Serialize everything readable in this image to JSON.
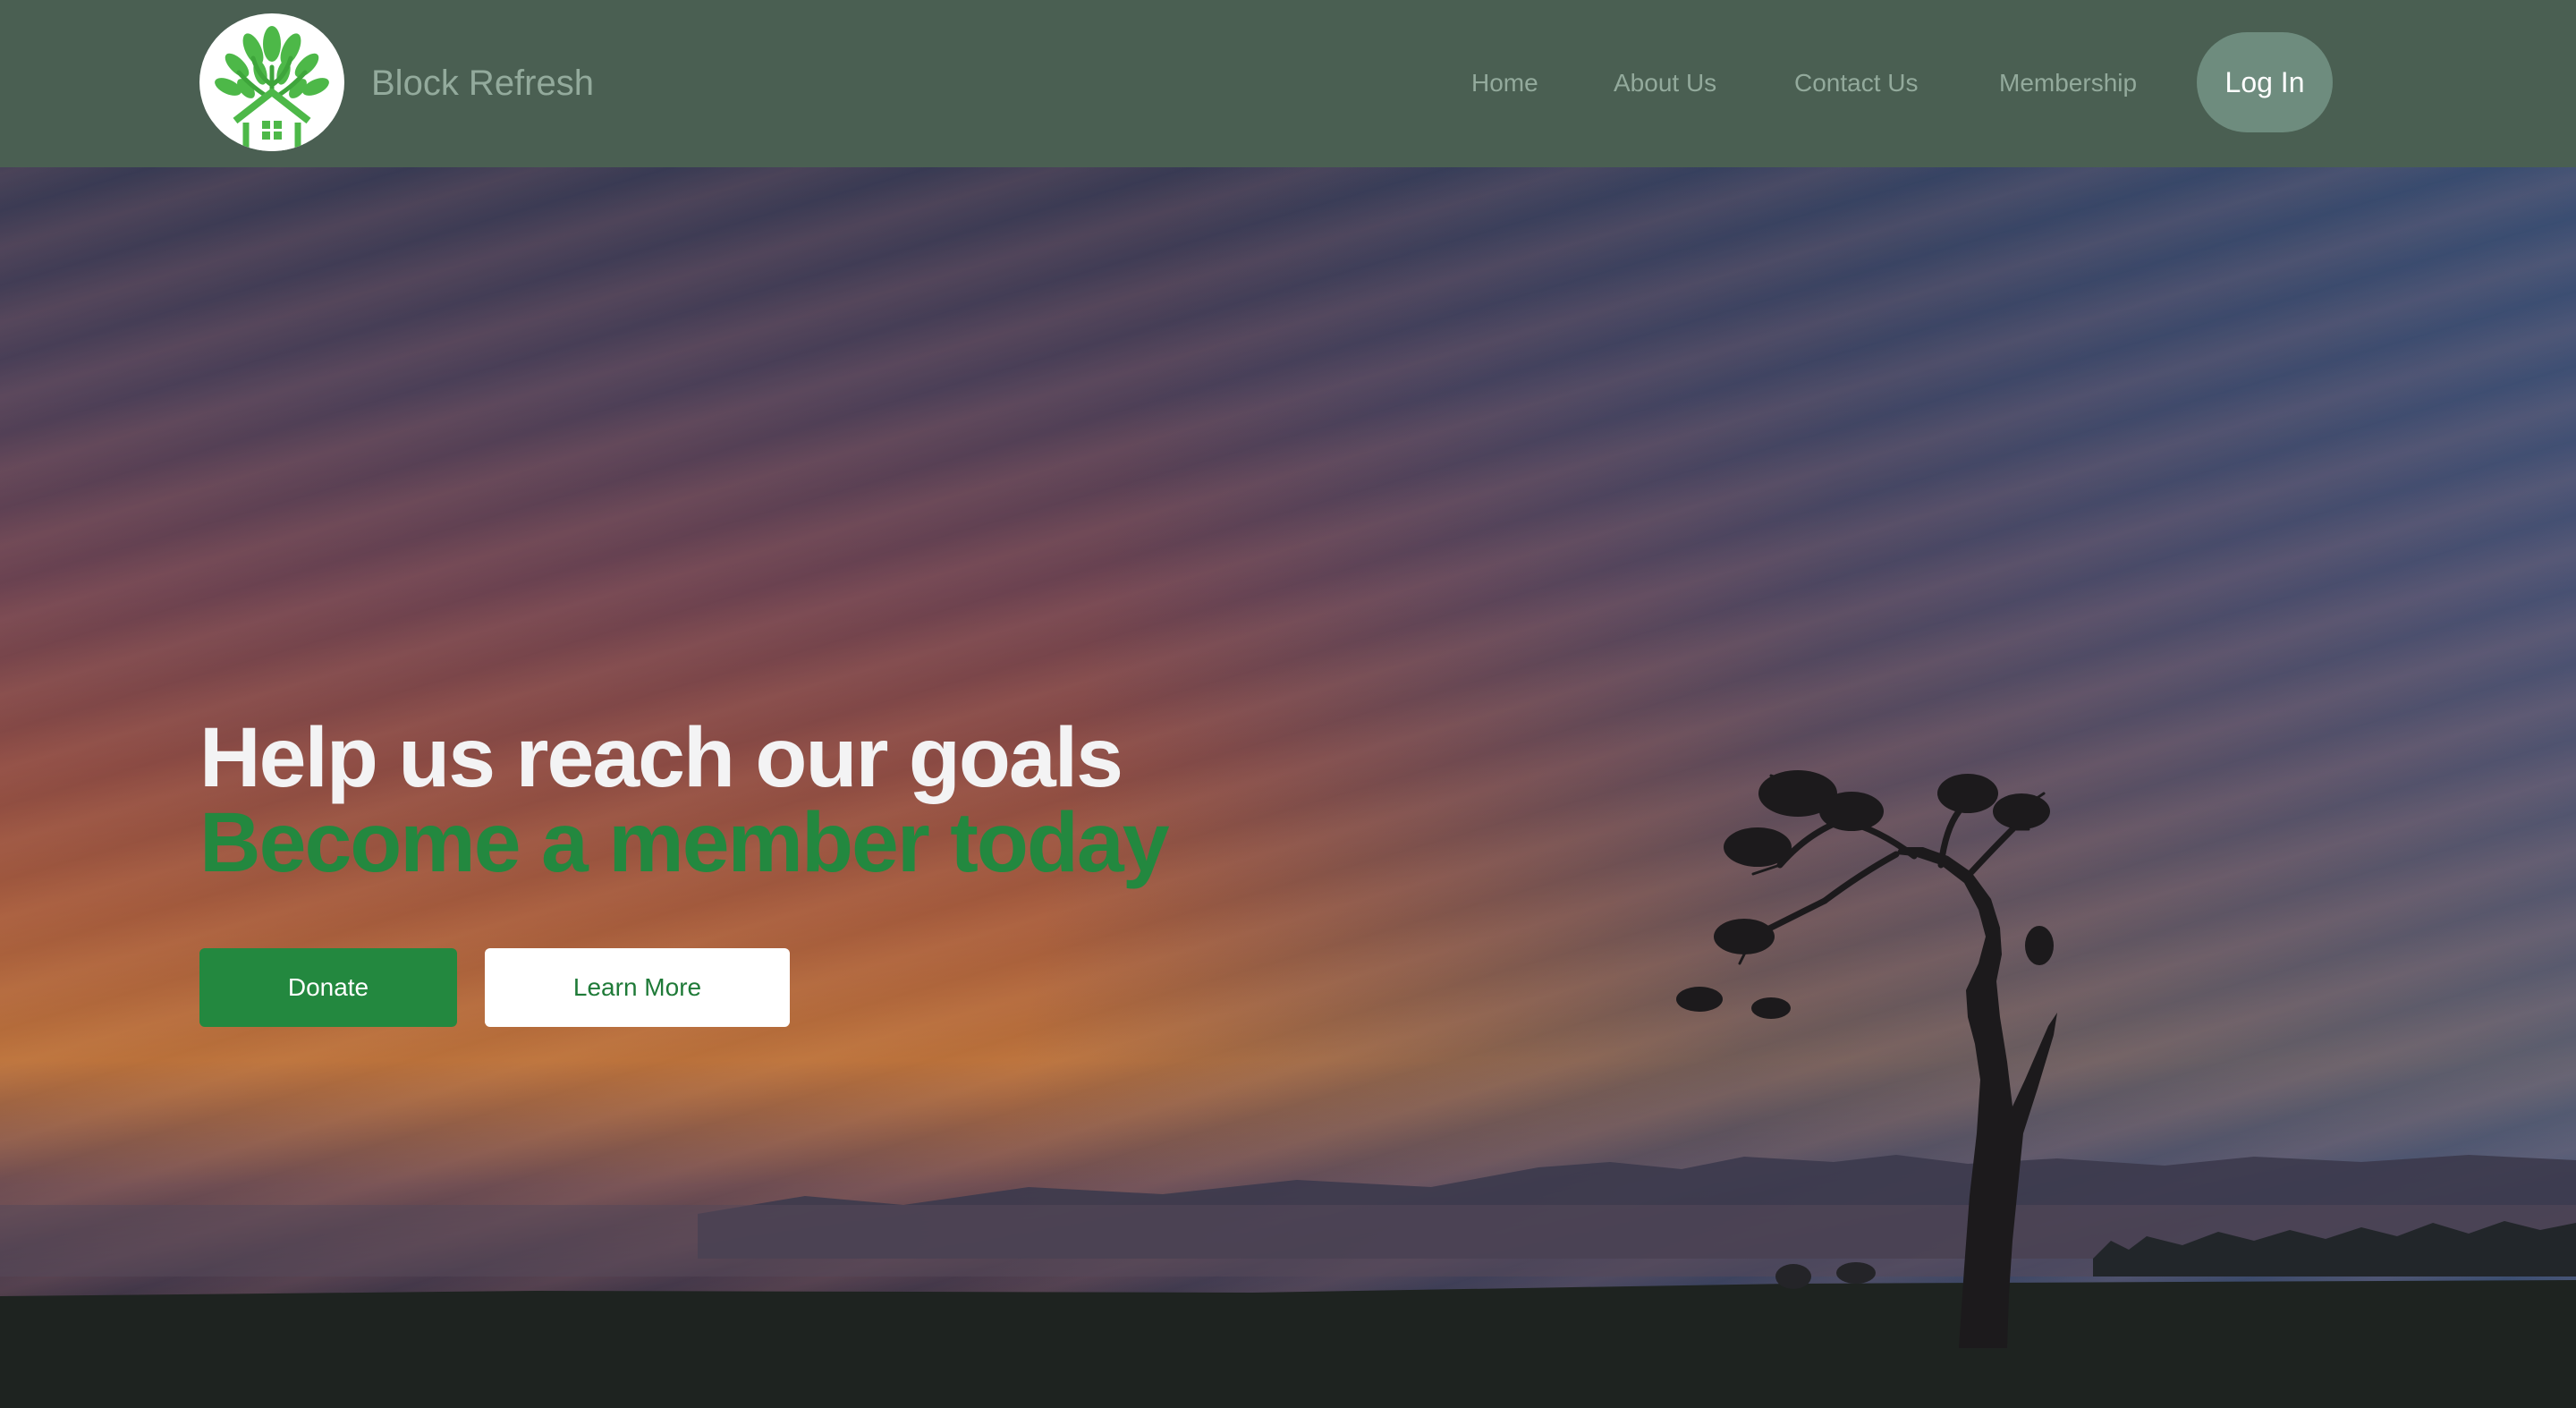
{
  "header": {
    "brand_name": "Block Refresh",
    "logo_icon": "tree-house-logo-icon",
    "nav": {
      "home": "Home",
      "about": "About Us",
      "contact": "Contact Us",
      "membership": "Membership"
    },
    "login_label": "Log In"
  },
  "hero": {
    "headline": "Help us reach our goals",
    "subheadline": "Become a member today",
    "donate_label": "Donate",
    "learn_more_label": "Learn More",
    "background_image": "sunset-sky-with-lone-tree-silhouette"
  },
  "colors": {
    "navbar_bg": "#4a5f52",
    "nav_text": "#93aa9c",
    "login_bg": "#6e8c7e",
    "accent_green": "#23883f",
    "headline_white": "#f3f3f4"
  }
}
